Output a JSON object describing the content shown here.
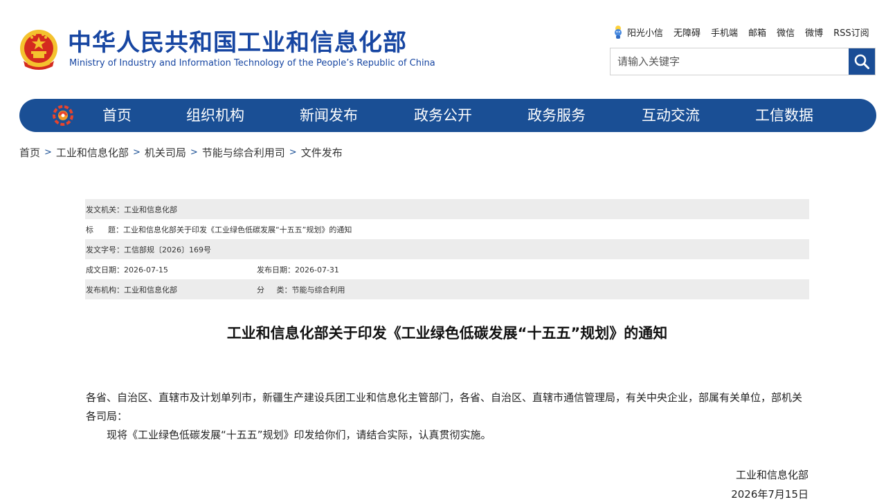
{
  "header": {
    "title_cn": "中华人民共和国工业和信息化部",
    "title_en": "Ministry of Industry and Information Technology of the People’s Republic of China",
    "links": [
      "阳光小信",
      "无障碍",
      "手机端",
      "邮箱",
      "微信",
      "微博",
      "RSS订阅"
    ],
    "search": {
      "placeholder": "请输入关键字",
      "value": ""
    }
  },
  "nav": {
    "items": [
      "首页",
      "组织机构",
      "新闻发布",
      "政务公开",
      "政务服务",
      "互动交流",
      "工信数据"
    ]
  },
  "breadcrumb": [
    "首页",
    "工业和信息化部",
    "机关司局",
    "节能与综合利用司",
    "文件发布"
  ],
  "info": {
    "issuer": "发文机关：工业和信息化部",
    "title": "标      题：工业和信息化部关于印发《工业绿色低碳发展“十五五”规划》的通知",
    "doc_number": "发文字号：工信部规〔2026〕169号",
    "written_date": "成文日期：2026-07-15",
    "publish_date": "发布日期：2026-07-31",
    "publisher": "发布机构：工业和信息化部",
    "category": "分     类：节能与综合利用"
  },
  "article": {
    "title": "工业和信息化部关于印发《工业绿色低碳发展“十五五”规划》的通知",
    "para1": "各省、自治区、直辖市及计划单列市，新疆生产建设兵团工业和信息化主管部门，各省、自治区、直辖市通信管理局，有关中央企业，部属有关单位，部机关各司局：",
    "para2": "现将《工业绿色低碳发展“十五五”规划》印发给你们，请结合实际，认真贯彻实施。",
    "signature_org": "工业和信息化部",
    "signature_date": "2026年7月15日"
  },
  "colors": {
    "brand_blue": "#1a4f95",
    "title_blue": "#1746a2",
    "emblem_red": "#d42a1f",
    "emblem_gold": "#f4c22e",
    "row_shade": "#ececec"
  },
  "icons": [
    "national-emblem-icon",
    "sunshine-xiaoxin-icon",
    "search-icon",
    "nav-logo-icon"
  ]
}
